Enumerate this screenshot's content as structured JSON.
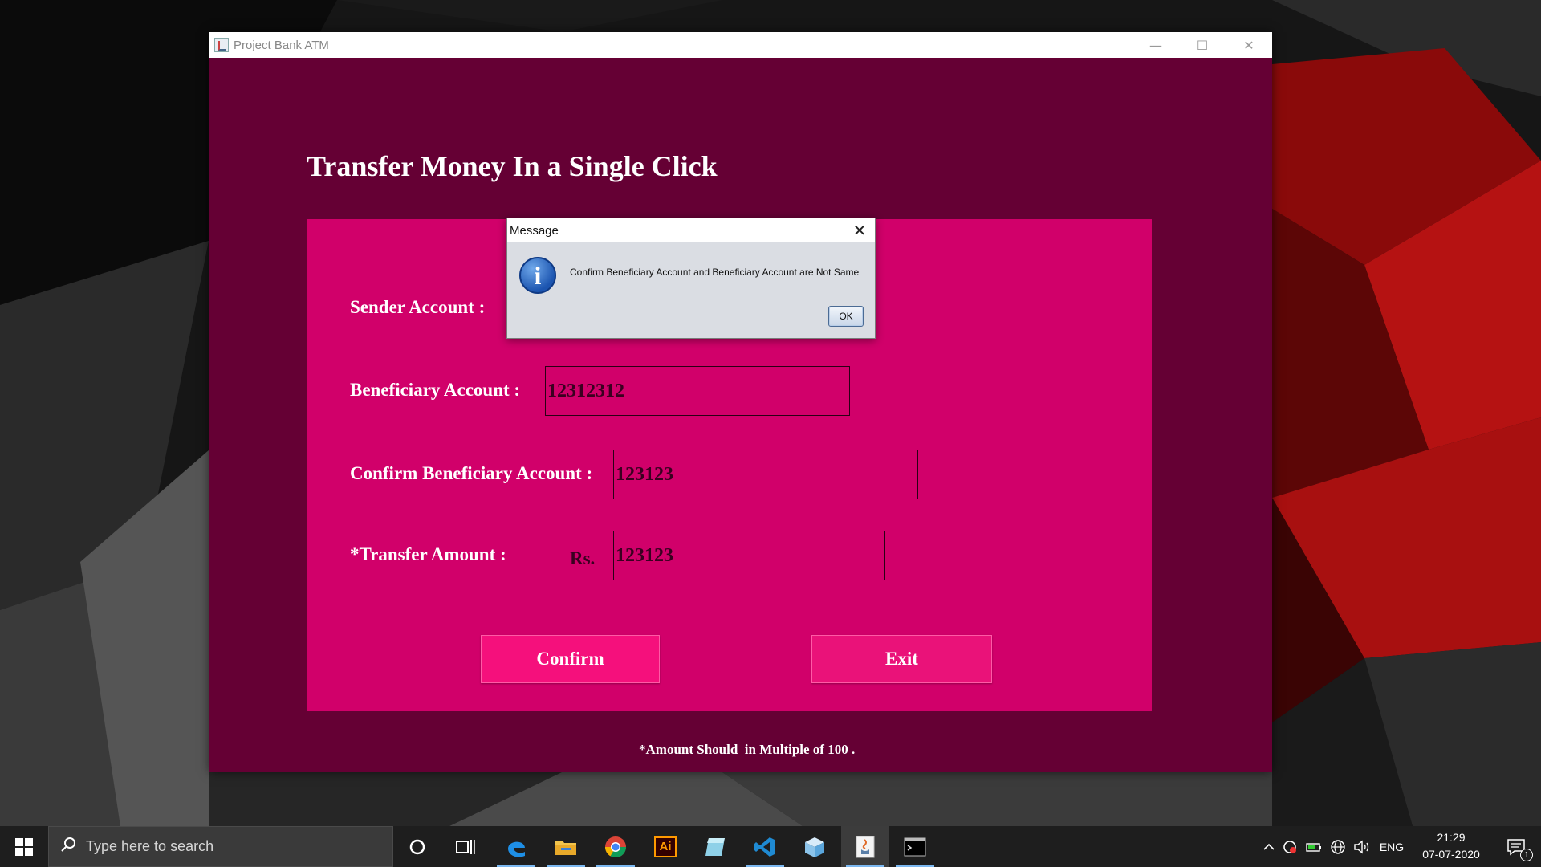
{
  "window": {
    "title": "Project Bank ATM",
    "minimize_glyph": "—",
    "maximize_glyph": "☐",
    "close_glyph": "✕"
  },
  "page": {
    "heading": "Transfer Money In a Single Click",
    "footnote": "*Amount Should  in Multiple of 100 ."
  },
  "form": {
    "sender_label": "Sender Account :",
    "beneficiary_label": "Beneficiary Account :",
    "beneficiary_value": "12312312",
    "confirm_label": "Confirm Beneficiary Account :",
    "confirm_value": "123123",
    "amount_label": "*Transfer Amount :",
    "currency_label": "Rs.",
    "amount_value": "123123",
    "confirm_button": "Confirm",
    "exit_button": "Exit"
  },
  "dialog": {
    "title": "Message",
    "icon": "information-icon",
    "icon_glyph": "i",
    "message": "Confirm Beneficiary Account and Beneficiary Account are Not Same",
    "ok_button": "OK",
    "close_glyph": "✕"
  },
  "taskbar": {
    "search_placeholder": "Type here to search",
    "pinned_apps": [
      "cortana-icon",
      "task-view-icon",
      "edge-icon",
      "file-explorer-icon",
      "chrome-icon",
      "illustrator-icon",
      "notepad-icon",
      "vscode-icon",
      "3d-box-icon",
      "java-icon",
      "terminal-icon"
    ],
    "illustrator_text": "Ai",
    "language": "ENG",
    "time": "21:29",
    "date": "07-07-2020",
    "notification_count": "1"
  },
  "colors": {
    "window_bg": "#650034",
    "panel_bg": "#d1006a",
    "button_bg": "#f5107c",
    "taskbar_bg": "#1e1e1e"
  }
}
